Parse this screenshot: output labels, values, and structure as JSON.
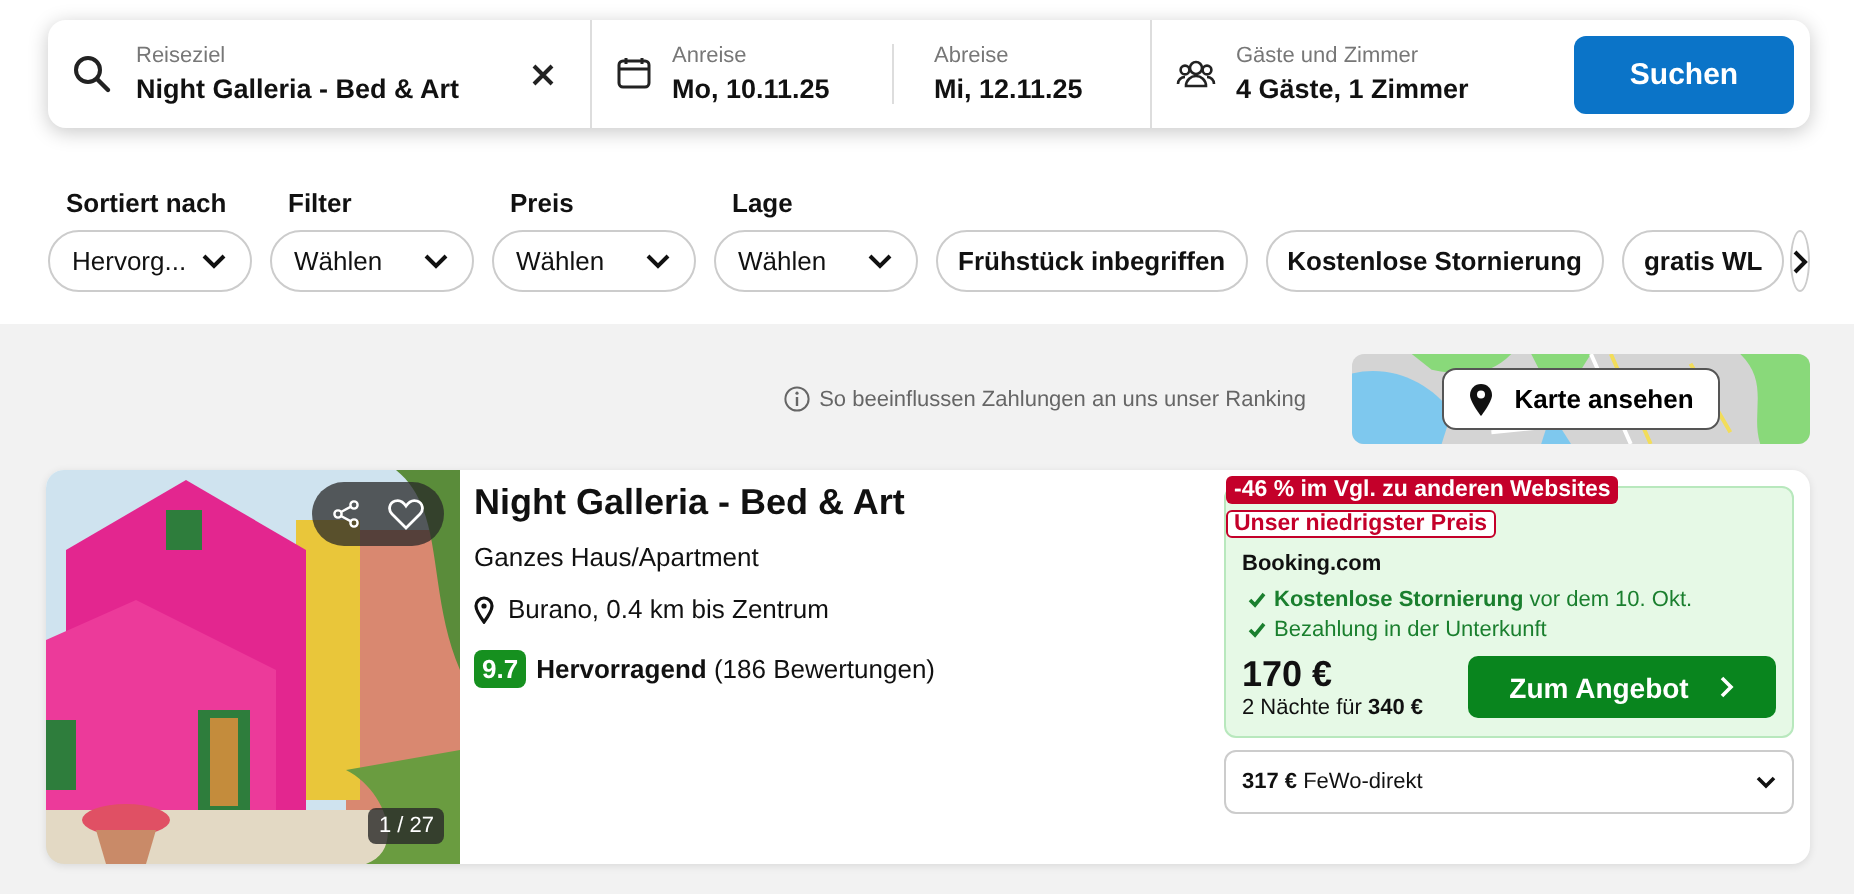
{
  "search": {
    "destination": {
      "label": "Reiseziel",
      "value": "Night Galleria - Bed & Art"
    },
    "checkin": {
      "label": "Anreise",
      "value": "Mo, 10.11.25"
    },
    "checkout": {
      "label": "Abreise",
      "value": "Mi, 12.11.25"
    },
    "guests": {
      "label": "Gäste und Zimmer",
      "value": "4 Gäste, 1 Zimmer"
    },
    "button": "Suchen"
  },
  "filters": [
    {
      "label": "Sortiert nach",
      "value": "Hervorg..."
    },
    {
      "label": "Filter",
      "value": "Wählen"
    },
    {
      "label": "Preis",
      "value": "Wählen"
    },
    {
      "label": "Lage",
      "value": "Wählen"
    }
  ],
  "chips": [
    "Frühstück inbegriffen",
    "Kostenlose Stornierung",
    "gratis WL"
  ],
  "ranking_note": "So beeinflussen Zahlungen an uns unser Ranking",
  "map_button": "Karte ansehen",
  "result": {
    "image_counter": "1 / 27",
    "favorite": false,
    "name": "Night Galleria - Bed & Art",
    "type": "Ganzes Haus/Apartment",
    "location": "Burano, 0.4 km bis Zentrum",
    "score": "9.7",
    "rating": "**Hervorragend** (186 Bewertungen)",
    "discount_badge": "-46 % im Vgl. zu anderen Websites",
    "lowest_badge": "Unser niedrigster Preis",
    "provider": "Booking.com",
    "features": [
      "**Kostenlose Stornierung** vor dem 10. Okt.",
      "Bezahlung in der Unterkunft"
    ],
    "price": "170 €",
    "total": "2 Nächte für **340 €**",
    "deal_button": "Zum Angebot",
    "other_offer": "**317 €** FeWo-direkt"
  }
}
